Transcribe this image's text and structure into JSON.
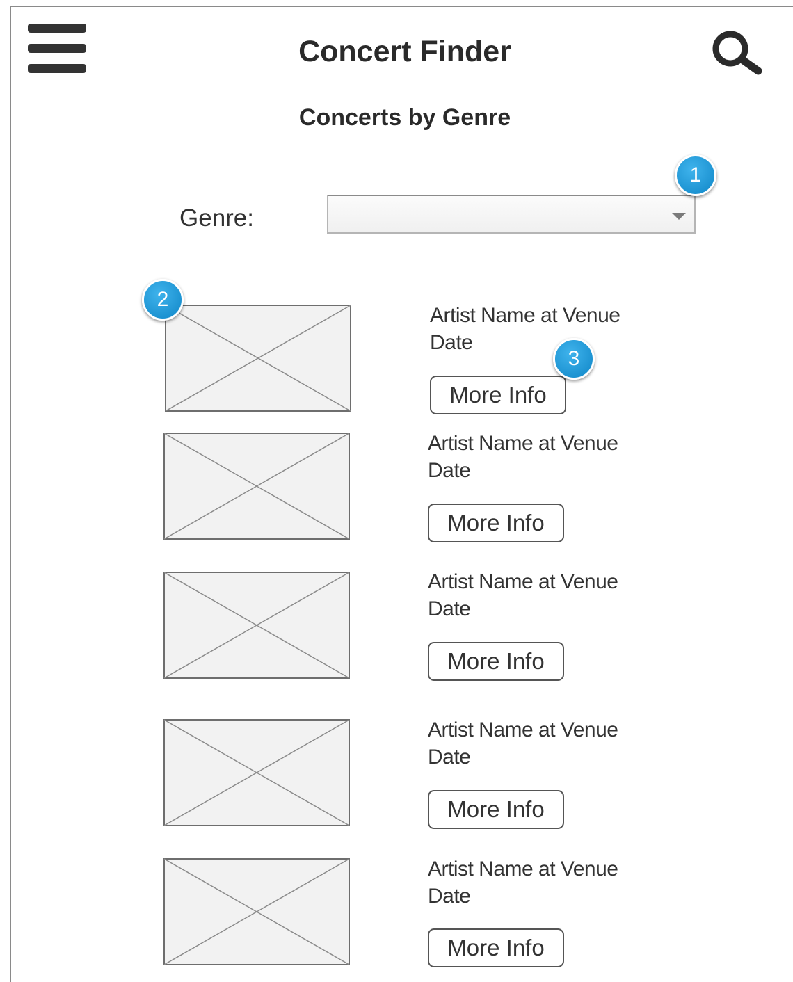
{
  "header": {
    "title": "Concert Finder",
    "menu_icon": "hamburger-menu-icon",
    "search_icon": "search-icon"
  },
  "page": {
    "subtitle": "Concerts by Genre"
  },
  "filter": {
    "label": "Genre:",
    "selected_value": ""
  },
  "concerts": [
    {
      "line1": "Artist Name at Venue",
      "line2": "Date",
      "button_label": "More Info",
      "image_icon": "image-placeholder-icon"
    },
    {
      "line1": "Artist Name at Venue",
      "line2": "Date",
      "button_label": "More Info",
      "image_icon": "image-placeholder-icon"
    },
    {
      "line1": "Artist Name at Venue",
      "line2": "Date",
      "button_label": "More Info",
      "image_icon": "image-placeholder-icon"
    },
    {
      "line1": "Artist Name at Venue",
      "line2": "Date",
      "button_label": "More Info",
      "image_icon": "image-placeholder-icon"
    },
    {
      "line1": "Artist Name at Venue",
      "line2": "Date",
      "button_label": "More Info",
      "image_icon": "image-placeholder-icon"
    }
  ],
  "callouts": [
    "1",
    "2",
    "3"
  ],
  "colors": {
    "callout_blue": "#1a9ad8",
    "frame_border": "#8a8a8a",
    "placeholder_fill": "#f2f2f2"
  }
}
